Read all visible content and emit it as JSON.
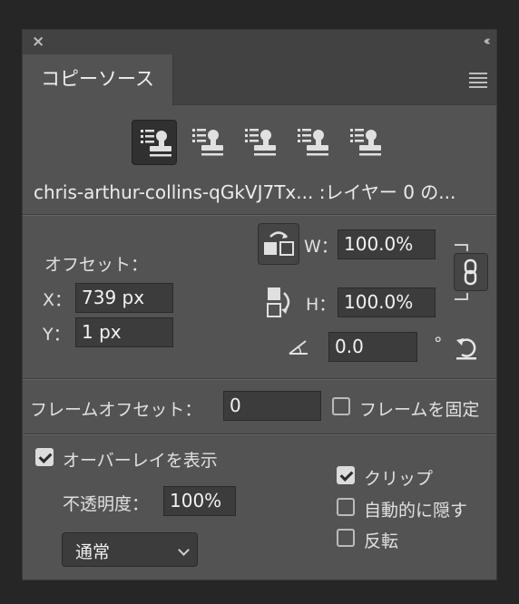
{
  "panel": {
    "title_close": "×",
    "title_collapse": "‹‹",
    "tab_label": "コピーソース"
  },
  "sources": {
    "buttons": [
      "clone-source-1",
      "clone-source-2",
      "clone-source-3",
      "clone-source-4",
      "clone-source-5"
    ],
    "active_index": 0,
    "name": "chris-arthur-collins-qGkVJ7Tx... :レイヤー 0 の..."
  },
  "offset": {
    "label": "オフセット：",
    "x_label": "X：",
    "x_value": "739 px",
    "y_label": "Y：",
    "y_value": "1 px",
    "w_label": "W：",
    "w_value": "100.0%",
    "h_label": "H：",
    "h_value": "100.0%",
    "angle_value": "0.0",
    "degree_symbol": "°"
  },
  "frame": {
    "label": "フレームオフセット：",
    "value": "0",
    "lock_label": "フレームを固定",
    "lock_checked": false
  },
  "overlay": {
    "show_label": "オーバーレイを表示",
    "show_checked": true,
    "opacity_label": "不透明度：",
    "opacity_value": "100%",
    "blend_mode": "通常",
    "clip_label": "クリップ",
    "clip_checked": true,
    "auto_hide_label": "自動的に隠す",
    "auto_hide_checked": false,
    "invert_label": "反転",
    "invert_checked": false
  }
}
